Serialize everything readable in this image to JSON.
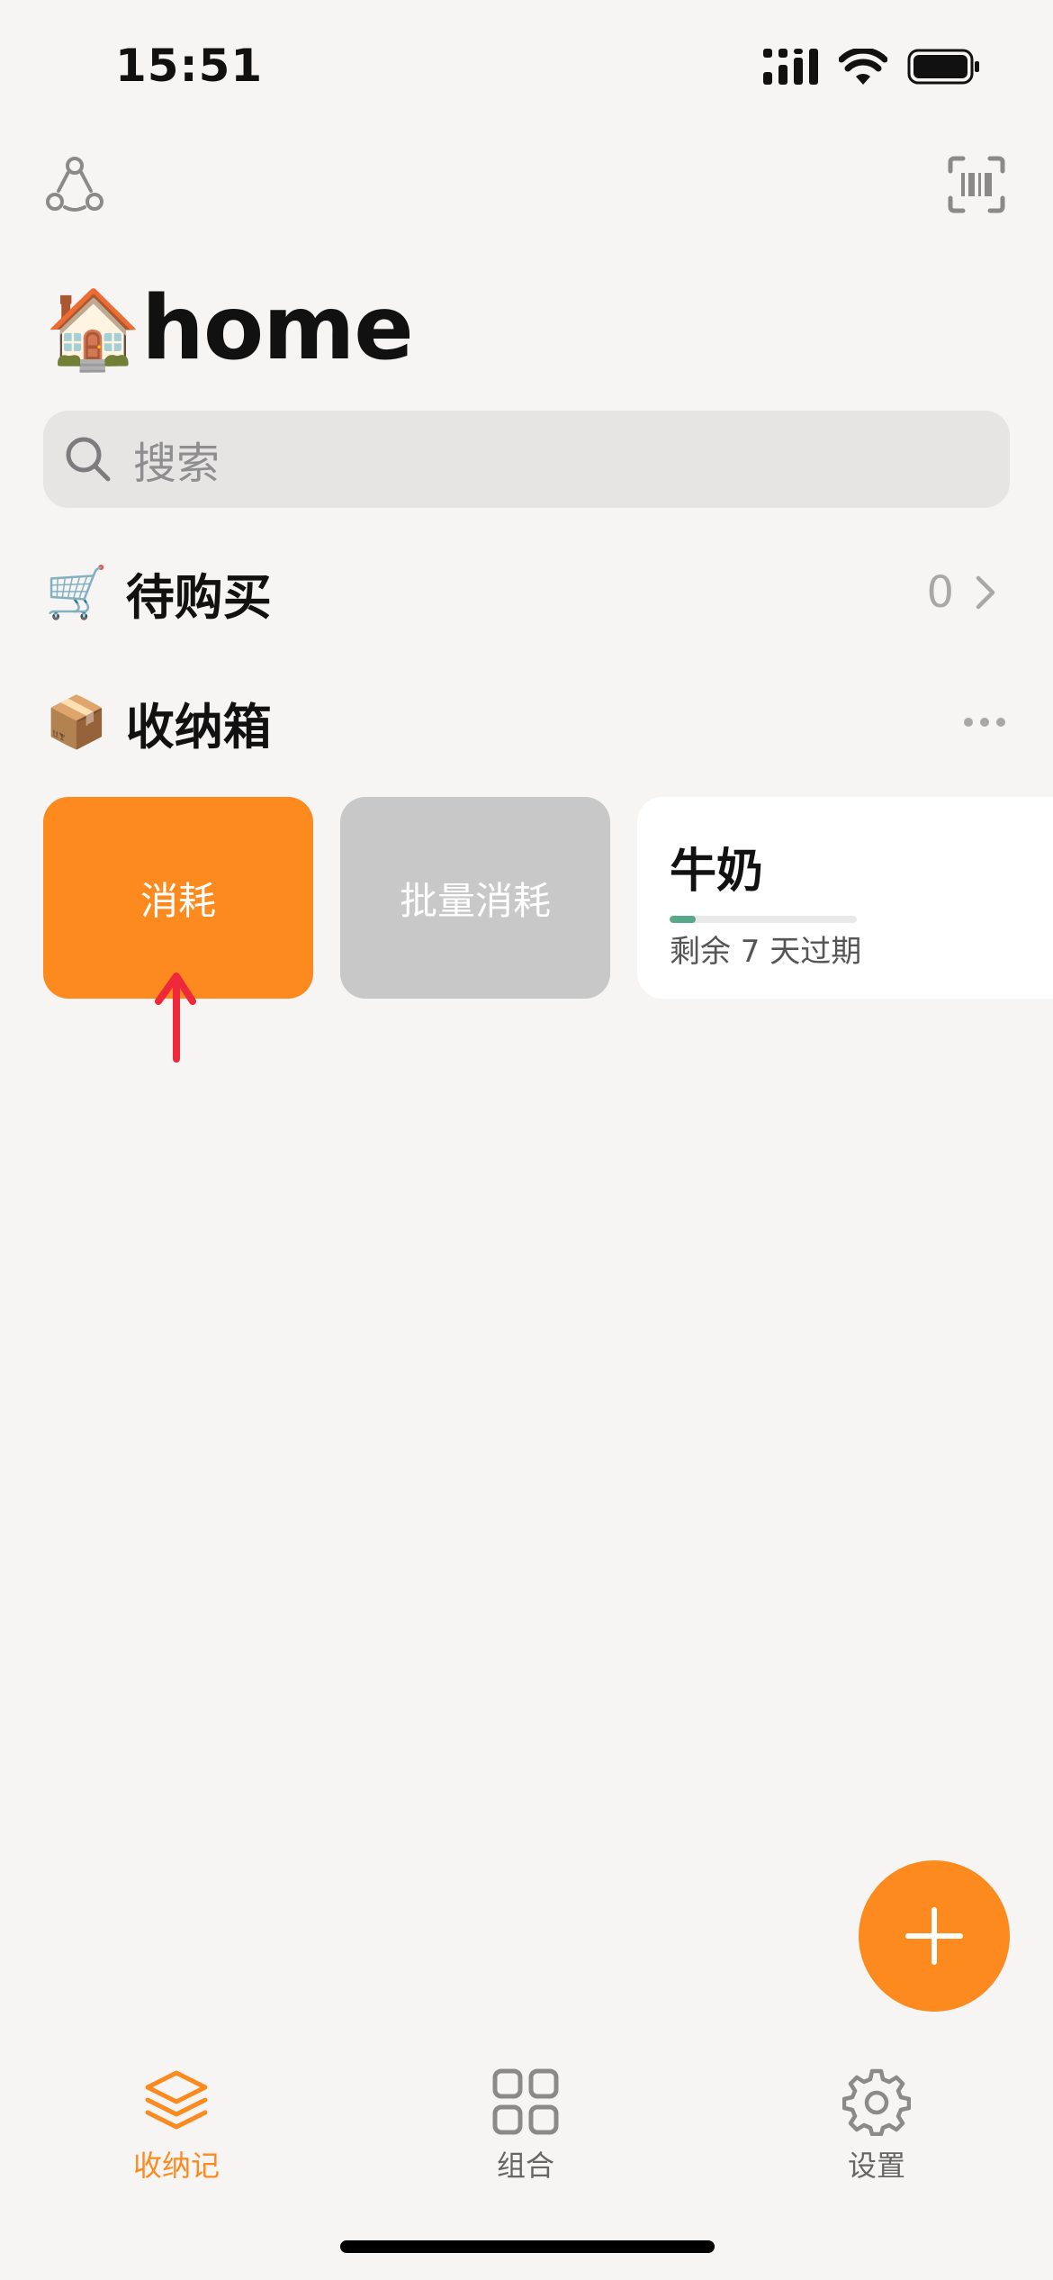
{
  "status_bar": {
    "time": "15:51"
  },
  "header": {
    "title_emoji": "🏠",
    "title": "home"
  },
  "search": {
    "placeholder": "搜索"
  },
  "shopping": {
    "emoji": "🛒",
    "label": "待购买",
    "count": "0"
  },
  "storage": {
    "emoji": "📦",
    "label": "收纳箱"
  },
  "cards": {
    "consume_label": "消耗",
    "batch_label": "批量消耗",
    "item": {
      "name": "牛奶",
      "expiry": "剩余 7 天过期",
      "remaining_fraction": 0.14
    }
  },
  "tabs": [
    {
      "label": "收纳记",
      "active": true
    },
    {
      "label": "组合",
      "active": false
    },
    {
      "label": "设置",
      "active": false
    }
  ],
  "colors": {
    "accent": "#fc8a1e",
    "background": "#f6f5f3",
    "search_bg": "#e6e5e3",
    "batch_card": "#c8c8c8",
    "progress": "#5aa88a",
    "arrow": "#f0283c"
  }
}
